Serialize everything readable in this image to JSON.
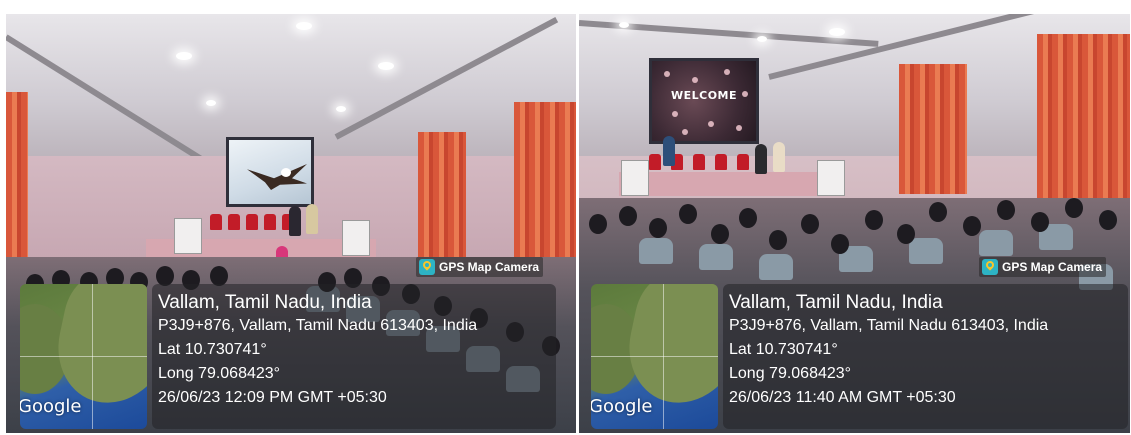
{
  "photos": [
    {
      "screen_caption": "",
      "overlay": {
        "app_tag": "GPS Map Camera",
        "app_icon": "gps-map-camera-icon",
        "map_brand": "Google",
        "place": "Vallam, Tamil Nadu, India",
        "address": "P3J9+876, Vallam, Tamil Nadu 613403, India",
        "lat": "Lat 10.730741°",
        "long": "Long 79.068423°",
        "datetime": "26/06/23 12:09 PM GMT +05:30"
      }
    },
    {
      "screen_caption": "WELCOME",
      "overlay": {
        "app_tag": "GPS Map Camera",
        "app_icon": "gps-map-camera-icon",
        "map_brand": "Google",
        "place": "Vallam, Tamil Nadu, India",
        "address": "P3J9+876, Vallam, Tamil Nadu 613403, India",
        "lat": "Lat 10.730741°",
        "long": "Long 79.068423°",
        "datetime": "26/06/23 11:40 AM GMT +05:30"
      }
    }
  ],
  "colors": {
    "curtain": "#e0603e",
    "wall": "#c9a9b3",
    "chairs_stage": "#c21c28",
    "overlay_bg": "#232326",
    "app_icon": "#2db3c4"
  }
}
